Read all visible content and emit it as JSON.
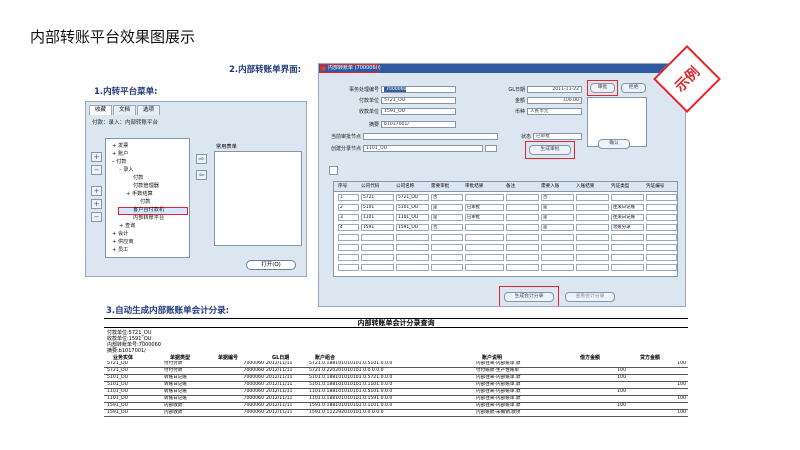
{
  "page": {
    "title": "内部转账平台效果图展示",
    "stamp": "示例",
    "sections": {
      "menu": "1.内转平台菜单:",
      "form": "2.内部转账单界面:",
      "accounting": "3.自动生成内部账账单会计分录:"
    }
  },
  "menu_panel": {
    "tabs": [
      "收藏",
      "文档",
      "选项"
    ],
    "path": "付款：录入：内部转账平台",
    "tree": [
      {
        "text": "+ 发票",
        "indent": 0
      },
      {
        "text": "+ 账户",
        "indent": 0
      },
      {
        "text": "– 付款",
        "indent": 0
      },
      {
        "text": "– 录入",
        "indent": 1
      },
      {
        "text": "付款",
        "indent": 3
      },
      {
        "text": "付款管理器",
        "indent": 3
      },
      {
        "text": "+ 手数结算",
        "indent": 2
      },
      {
        "text": "付款",
        "indent": 4
      },
      {
        "text": "客户台付款机",
        "indent": 3
      },
      {
        "text": "内部转账平台",
        "indent": 3
      },
      {
        "text": "+ 查询",
        "indent": 1
      },
      {
        "text": "+ 会计",
        "indent": 0
      },
      {
        "text": "+ 供应商",
        "indent": 0
      },
      {
        "text": "+ 员工",
        "indent": 0
      }
    ],
    "favorites_label": "常用表单",
    "side_buttons": [
      "+",
      "−",
      "+",
      "+",
      "−"
    ],
    "mid_buttons": [
      "⇨",
      "⇦"
    ],
    "open_button": "打开(O)"
  },
  "form_panel": {
    "window_title": "内部转账单 (7000060)",
    "fields": {
      "doc_no_label": "事务处理编号",
      "doc_no": "7000060",
      "date_label": "GL日期",
      "date": "2011-11-22",
      "payer_label": "付款单位",
      "payer": "5721_OU",
      "amount_label": "金额",
      "amount": "100.00",
      "payee_label": "收款单位",
      "payee": "1591_OU",
      "currency_label": "币种",
      "currency": "人民币元",
      "summary_label": "摘要",
      "summary": "b1017001/",
      "approver_label": "当前审批节点",
      "approver": "",
      "status_label": "状态",
      "status": "已审批",
      "reviewer_label": "创建分录节点",
      "reviewer": "1101_OU"
    },
    "buttons": {
      "submit": "审批",
      "cancel": "拒绝",
      "generate": "生成审批",
      "confirm": "确认",
      "gen_entries": "生成会计分录",
      "view_entries": "查看会计分录"
    },
    "grid_headers": [
      "序号",
      "公司代码",
      "公司名称",
      "需要审批",
      "审批结果",
      "备注",
      "需要入账",
      "入账结果",
      "凭证类型",
      "凭证编号"
    ],
    "grid_rows": [
      [
        "1",
        "5721",
        "5721_OU",
        "否",
        "",
        "",
        "否",
        "",
        "",
        ""
      ],
      [
        "2",
        "5101",
        "5101_OU",
        "是",
        "已审批",
        "",
        "是",
        "",
        "往来日记账",
        ""
      ],
      [
        "3",
        "1101",
        "1101_OU",
        "是",
        "已审批",
        "",
        "是",
        "",
        "往来日记账",
        ""
      ],
      [
        "4",
        "1591",
        "1591_OU",
        "否",
        "",
        "",
        "是",
        "",
        "总账分录",
        ""
      ],
      [
        "",
        "",
        "",
        "",
        "",
        "",
        "",
        "",
        "",
        ""
      ],
      [
        "",
        "",
        "",
        "",
        "",
        "",
        "",
        "",
        "",
        ""
      ],
      [
        "",
        "",
        "",
        "",
        "",
        "",
        "",
        "",
        "",
        ""
      ],
      [
        "",
        "",
        "",
        "",
        "",
        "",
        "",
        "",
        "",
        ""
      ]
    ]
  },
  "accounting": {
    "title": "内部转账单会计分录查询",
    "info": [
      "付款单位:5721_OU",
      "收款单位:1591_OU",
      "内部转账单号:7000060",
      "摘要:b1017001/"
    ],
    "headers": [
      "业务实体",
      "单据类型",
      "单据编号",
      "GL日期",
      "账户组合",
      "账户说明",
      "借方金额",
      "贷方金额"
    ],
    "rows": [
      [
        "5721_OU",
        "付付付款",
        "7000060",
        "2012/11/11",
        "5721.0.188101010101.0.5101.0.0.0",
        "内部往来-内部账单.款",
        "",
        "100"
      ],
      [
        "5721_OU",
        "付付付款",
        "7000060",
        "2012/11/11",
        "5721.0.220201010101.0.0.0.0.0",
        "付付账款-生产性账单",
        "100",
        ""
      ],
      [
        "5101_OU",
        "转账日记账",
        "7000060",
        "2012/11/11",
        "5101.0.188101010101.0.5721.0.0.0",
        "内部往来-内部账单.款",
        "100",
        ""
      ],
      [
        "5101_OU",
        "转账日记账",
        "7000060",
        "2012/11/11",
        "5101.0.188101010101.0.1101.0.0.0",
        "内部往来-内部账单.款",
        "",
        "100"
      ],
      [
        "1101_OU",
        "转账日记账",
        "7000060",
        "2012/11/11",
        "1101.0.188101010101.0.5101.0.0.0",
        "内部往来-内部账单.款",
        "100",
        ""
      ],
      [
        "1101_OU",
        "转账日记账",
        "7000060",
        "2012/11/11",
        "1101.0.188101010101.0.1591.0.0.0",
        "内部往来-内部账单.款",
        "",
        "100"
      ],
      [
        "1591_OU",
        "内部收款",
        "7000060",
        "2012/11/11",
        "1591.0.188101010101.0.1101.0.0.0",
        "内部往来-内部账单.款",
        "100",
        ""
      ],
      [
        "1591_OU",
        "内部收款",
        "7000060",
        "2012/11/11",
        "1591.0.112292010101.0.0.0.0.0",
        "内部账款-未确销.款项",
        "",
        "100"
      ]
    ]
  }
}
